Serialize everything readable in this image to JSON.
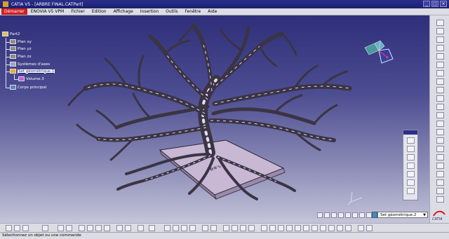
{
  "window": {
    "title": "CATIA V5 - [ARBRE FINAL.CATPart]",
    "buttons": [
      "_",
      "□",
      "×"
    ]
  },
  "menu": {
    "items": [
      {
        "label": "Démarrer"
      },
      {
        "label": "ENOVIA V5 VPM"
      },
      {
        "label": "Fichier"
      },
      {
        "label": "Edition"
      },
      {
        "label": "Affichage"
      },
      {
        "label": "Insertion"
      },
      {
        "label": "Outils"
      },
      {
        "label": "Fenêtre"
      },
      {
        "label": "Aide"
      }
    ]
  },
  "tree": {
    "root": "Part2",
    "items": [
      {
        "label": "Plan xy",
        "icon": "plane-icon"
      },
      {
        "label": "Plan yz",
        "icon": "plane-icon"
      },
      {
        "label": "Plan zx",
        "icon": "plane-icon"
      },
      {
        "label": "Systèmes d'axes",
        "icon": "axis-system-icon"
      },
      {
        "label": "Set géométrique.1",
        "icon": "geometric-set-icon"
      },
      {
        "label": "Volume.3",
        "icon": "volume-icon"
      },
      {
        "label": "Corps principal",
        "icon": "body-icon"
      }
    ]
  },
  "toolbar": {
    "current_set": "Set géométrique.2"
  },
  "status": {
    "text": "Sélectionnez un objet ou une commande"
  },
  "colors": {
    "tree_model": "#3a3444",
    "tree_highlight": "#e6dcf0",
    "base_plate": "#c8b8d4",
    "viewport_top": "#2f2f7a",
    "viewport_bottom": "#c4c4da"
  }
}
